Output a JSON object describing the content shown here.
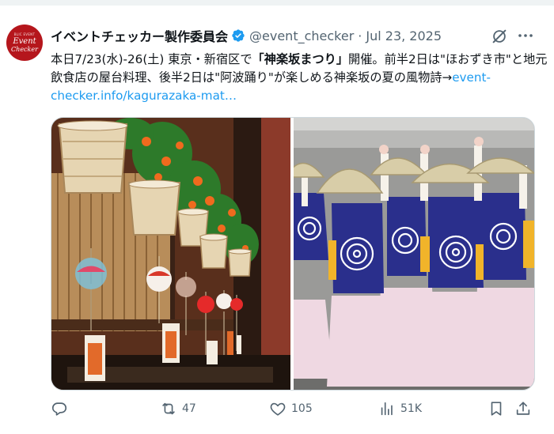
{
  "account": {
    "avatar_small": "BLIC EVENT",
    "avatar_line1": "Event",
    "avatar_line2": "Checker",
    "display_name": "イベントチェッカー製作委員会",
    "handle": "@event_checker",
    "separator": "·",
    "date": "Jul 23, 2025"
  },
  "post": {
    "text_1": "本日7/23(水)-26(土) 東京・新宿区で",
    "text_bold": "「神楽坂まつり」",
    "text_2": "開催。前半2日は\"ほおずき市\"と地元飲食店の屋台料理、後半2日は\"阿波踊り\"が楽しめる神楽坂の夏の風物詩→",
    "link": "event-checker.info/kagurazaka-mat…"
  },
  "actions": {
    "replies": "",
    "reposts": "47",
    "likes": "105",
    "views": "51K"
  },
  "icons": {
    "verified": "verified-badge-icon",
    "grok": "grok-icon",
    "more": "more-icon",
    "reply": "reply-icon",
    "repost": "repost-icon",
    "like": "like-icon",
    "views": "views-icon",
    "bookmark": "bookmark-icon",
    "share": "share-icon"
  },
  "colors": {
    "accent": "#1d9bf0",
    "secondary_text": "#536471",
    "avatar_bg": "#b5161c"
  }
}
